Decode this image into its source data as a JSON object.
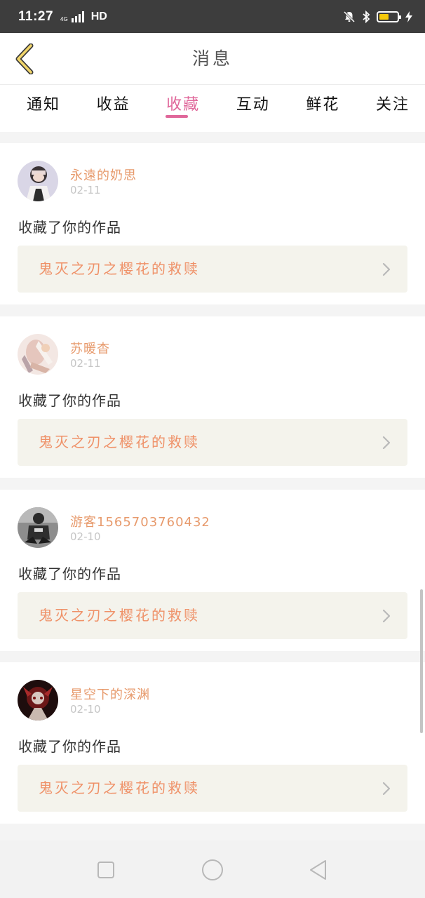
{
  "status_bar": {
    "time": "11:27",
    "network_tag": "4G",
    "hd": "HD",
    "battery_level": 0.55,
    "battery_color": "#f5c90a"
  },
  "header": {
    "title": "消息",
    "back_icon": "chevron-left-icon"
  },
  "tabs": [
    {
      "label": "通知",
      "active": false
    },
    {
      "label": "收益",
      "active": false
    },
    {
      "label": "收藏",
      "active": true
    },
    {
      "label": "互动",
      "active": false
    },
    {
      "label": "鲜花",
      "active": false
    },
    {
      "label": "关注",
      "active": false
    }
  ],
  "accent_color": "#e0679a",
  "feed": [
    {
      "username": "永遠的奶思",
      "date": "02-11",
      "action": "收藏了你的作品",
      "work_title": "鬼灭之刃之樱花的救赎"
    },
    {
      "username": "苏暖杳",
      "date": "02-11",
      "action": "收藏了你的作品",
      "work_title": "鬼灭之刃之樱花的救赎"
    },
    {
      "username": "游客1565703760432",
      "date": "02-10",
      "action": "收藏了你的作品",
      "work_title": "鬼灭之刃之樱花的救赎"
    },
    {
      "username": "星空下的深渊",
      "date": "02-10",
      "action": "收藏了你的作品",
      "work_title": "鬼灭之刃之樱花的救赎"
    }
  ],
  "nav_bar": {
    "icons": [
      "square-icon",
      "circle-icon",
      "triangle-back-icon"
    ]
  }
}
